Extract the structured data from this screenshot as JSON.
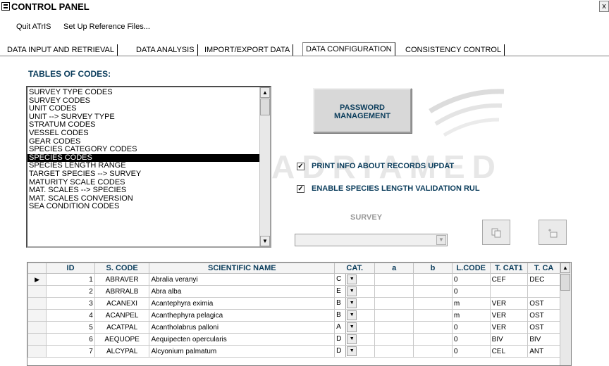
{
  "window": {
    "title": "CONTROL PANEL",
    "close_glyph": "x"
  },
  "menu": {
    "items": [
      "Quit ATrIS",
      "Set Up Reference Files..."
    ]
  },
  "tabs": [
    {
      "label": "DATA INPUT AND RETRIEVAL",
      "active": false
    },
    {
      "label": "DATA ANALYSIS",
      "active": false
    },
    {
      "label": "IMPORT/EXPORT DATA",
      "active": false
    },
    {
      "label": "DATA CONFIGURATION",
      "active": true
    },
    {
      "label": "CONSISTENCY CONTROL",
      "active": false
    }
  ],
  "watermark": "ADRIAMED",
  "tables_of_codes": {
    "label": "TABLES OF CODES:",
    "items": [
      "SURVEY TYPE CODES",
      "SURVEY CODES",
      "UNIT CODES",
      "UNIT --> SURVEY TYPE",
      "STRATUM CODES",
      "VESSEL CODES",
      "GEAR CODES",
      "SPECIES CATEGORY CODES",
      "SPECIES CODES",
      "SPECIES LENGTH RANGE",
      "TARGET SPECIES --> SURVEY",
      "MATURITY SCALE CODES",
      "MAT. SCALES --> SPECIES",
      "MAT. SCALES CONVERSION",
      "SEA CONDITION CODES"
    ],
    "selected": "SPECIES CODES"
  },
  "password_button": {
    "line1": "PASSWORD",
    "line2": "MANAGEMENT"
  },
  "options": {
    "print_info": {
      "label": "PRINT INFO ABOUT RECORDS UPDAT",
      "checked": true
    },
    "enable_validation": {
      "label": "ENABLE SPECIES LENGTH VALIDATION RUL",
      "checked": true
    }
  },
  "survey": {
    "label": "SURVEY",
    "value": ""
  },
  "icons": {
    "copy": "copy-icon",
    "new": "new-record-icon",
    "check": "✓"
  },
  "species_table": {
    "columns": [
      "ID",
      "S. CODE",
      "SCIENTIFIC NAME",
      "CAT.",
      "a",
      "b",
      "L.CODE",
      "T. CAT1",
      "T. CA"
    ],
    "rows": [
      {
        "id": "1",
        "scode": "ABRAVER",
        "name": "Abralia veranyi",
        "cat": "C",
        "a": "",
        "b": "",
        "lcode": "0",
        "tcat1": "CEF",
        "tcat2": "DEC"
      },
      {
        "id": "2",
        "scode": "ABRRALB",
        "name": "Abra alba",
        "cat": "E",
        "a": "",
        "b": "",
        "lcode": "0",
        "tcat1": "",
        "tcat2": ""
      },
      {
        "id": "3",
        "scode": "ACANEXI",
        "name": "Acantephyra eximia",
        "cat": "B",
        "a": "",
        "b": "",
        "lcode": "m",
        "tcat1": "VER",
        "tcat2": "OST"
      },
      {
        "id": "4",
        "scode": "ACANPEL",
        "name": "Acanthephyra pelagica",
        "cat": "B",
        "a": "",
        "b": "",
        "lcode": "m",
        "tcat1": "VER",
        "tcat2": "OST"
      },
      {
        "id": "5",
        "scode": "ACATPAL",
        "name": "Acantholabrus palloni",
        "cat": "A",
        "a": "",
        "b": "",
        "lcode": "0",
        "tcat1": "VER",
        "tcat2": "OST"
      },
      {
        "id": "6",
        "scode": "AEQUOPE",
        "name": "Aequipecten opercularis",
        "cat": "D",
        "a": "",
        "b": "",
        "lcode": "0",
        "tcat1": "BIV",
        "tcat2": "BIV"
      },
      {
        "id": "7",
        "scode": "ALCYPAL",
        "name": "Alcyonium palmatum",
        "cat": "D",
        "a": "",
        "b": "",
        "lcode": "0",
        "tcat1": "CEL",
        "tcat2": "ANT"
      }
    ],
    "current_row": 0
  }
}
